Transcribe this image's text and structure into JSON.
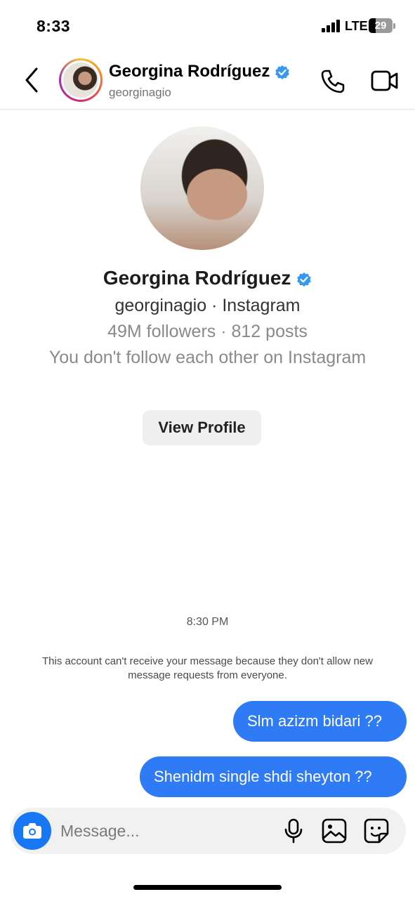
{
  "status_bar": {
    "time": "8:33",
    "network": "LTE",
    "battery": "29",
    "battery_level": 0.29
  },
  "header": {
    "name": "Georgina Rodríguez",
    "username": "georginagio",
    "verified": true,
    "accent_color": "#3897f0",
    "icons": [
      "back-arrow-icon",
      "phone-icon",
      "video-camera-icon"
    ]
  },
  "profile": {
    "name": "Georgina Rodríguez",
    "handle_line": "georginagio · Instagram",
    "stats_line": "49M followers · 812 posts",
    "follow_status": "You don't follow each other on Instagram",
    "view_profile_label": "View Profile"
  },
  "conversation": {
    "timestamp": "8:30 PM",
    "notice": "This account can't receive your message because they don't allow new message requests from everyone.",
    "messages": [
      {
        "text": "Slm azizm bidari ??",
        "sender": "me"
      },
      {
        "text": "Shenidm single shdi sheyton ??",
        "sender": "me"
      }
    ],
    "bubble_color": "#2f7bf5"
  },
  "composer": {
    "placeholder": "Message...",
    "icons": [
      "camera-icon",
      "microphone-icon",
      "gallery-icon",
      "sticker-icon"
    ]
  }
}
